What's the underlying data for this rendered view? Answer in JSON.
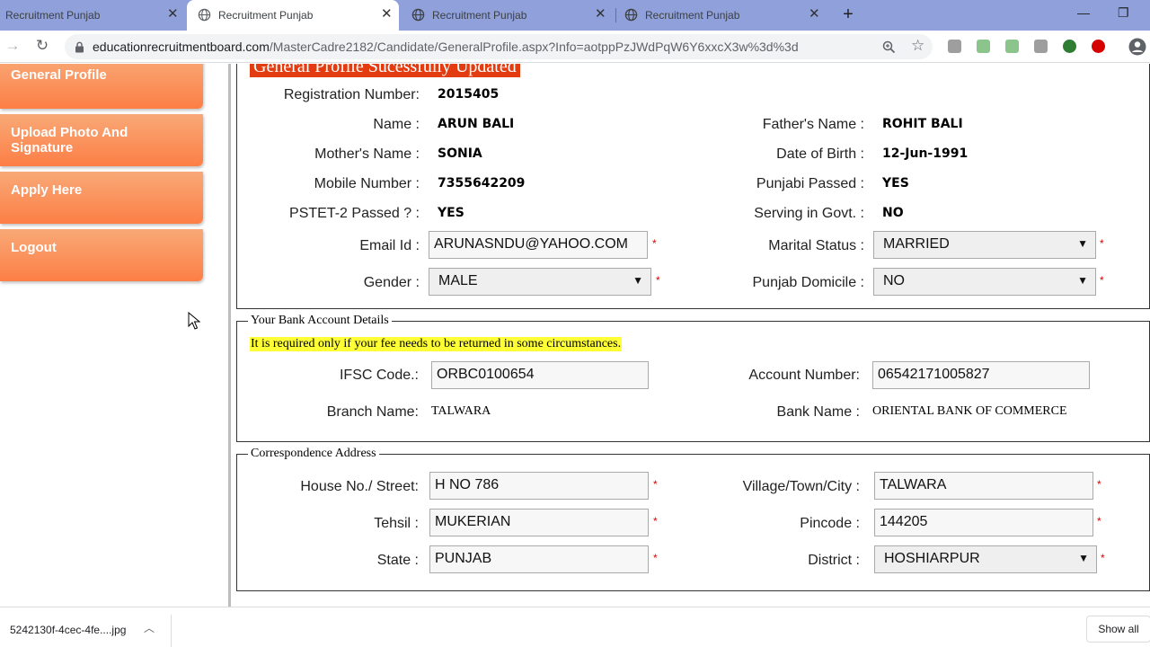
{
  "browser": {
    "tabs": [
      {
        "title": "Recruitment Punjab",
        "active": false
      },
      {
        "title": "Recruitment Punjab",
        "active": true
      },
      {
        "title": "Recruitment Punjab",
        "active": false
      },
      {
        "title": "Recruitment Punjab",
        "active": false
      }
    ],
    "url_host": "educationrecruitmentboard.com",
    "url_path": "/MasterCadre2182/Candidate/GeneralProfile.aspx?Info=aotppPzJWdPqW6Y6xxcX3w%3d%3d"
  },
  "sidebar": {
    "items": [
      {
        "label": "General Profile"
      },
      {
        "label": "Upload Photo And Signature"
      },
      {
        "label": "Apply Here"
      },
      {
        "label": "Logout"
      }
    ]
  },
  "profile": {
    "banner": "General Profile Sucessfully Updated",
    "registration_label": "Registration Number:",
    "registration_value": "2015405",
    "name_label": "Name :",
    "name_value": "ARUN BALI",
    "father_label": "Father's Name :",
    "father_value": "ROHIT BALI",
    "mother_label": "Mother's Name :",
    "mother_value": "SONIA",
    "dob_label": "Date of Birth :",
    "dob_value": "12-Jun-1991",
    "mobile_label": "Mobile Number :",
    "mobile_value": "7355642209",
    "punjabi_label": "Punjabi Passed :",
    "punjabi_value": "YES",
    "pstet_label": "PSTET-2 Passed ? :",
    "pstet_value": "YES",
    "serving_label": "Serving in Govt. :",
    "serving_value": "NO",
    "email_label": "Email Id :",
    "email_value": "ARUNASNDU@YAHOO.COM",
    "marital_label": "Marital Status :",
    "marital_value": "MARRIED",
    "gender_label": "Gender :",
    "gender_value": "MALE",
    "domicile_label": "Punjab Domicile :",
    "domicile_value": "NO",
    "required_mark": "*"
  },
  "bank": {
    "legend": "Your Bank Account Details",
    "note": "It is required only if your fee needs to be returned in some circumstances.",
    "ifsc_label": "IFSC Code.:",
    "ifsc_value": "ORBC0100654",
    "account_label": "Account Number:",
    "account_value": "06542171005827",
    "branch_label": "Branch Name:",
    "branch_value": "TALWARA",
    "bankname_label": "Bank Name :",
    "bankname_value": "ORIENTAL BANK OF COMMERCE"
  },
  "address": {
    "legend": "Correspondence Address",
    "house_label": "House No./ Street:",
    "house_value": "H NO 786",
    "village_label": "Village/Town/City :",
    "village_value": "TALWARA",
    "tehsil_label": "Tehsil :",
    "tehsil_value": "MUKERIAN",
    "pincode_label": "Pincode :",
    "pincode_value": "144205",
    "state_label": "State :",
    "state_value": "PUNJAB",
    "district_label": "District :",
    "district_value": "HOSHIARPUR"
  },
  "downloads": {
    "filename": "5242130f-4cec-4fe....jpg",
    "show_all": "Show all"
  },
  "colors": {
    "tabstrip": "#8fa0da",
    "sidebar_gradient_top": "#f8a977",
    "sidebar_gradient_bottom": "#fd7e46",
    "banner": "#e23c10",
    "note_highlight": "#ffff36",
    "required": "#dd0000"
  }
}
